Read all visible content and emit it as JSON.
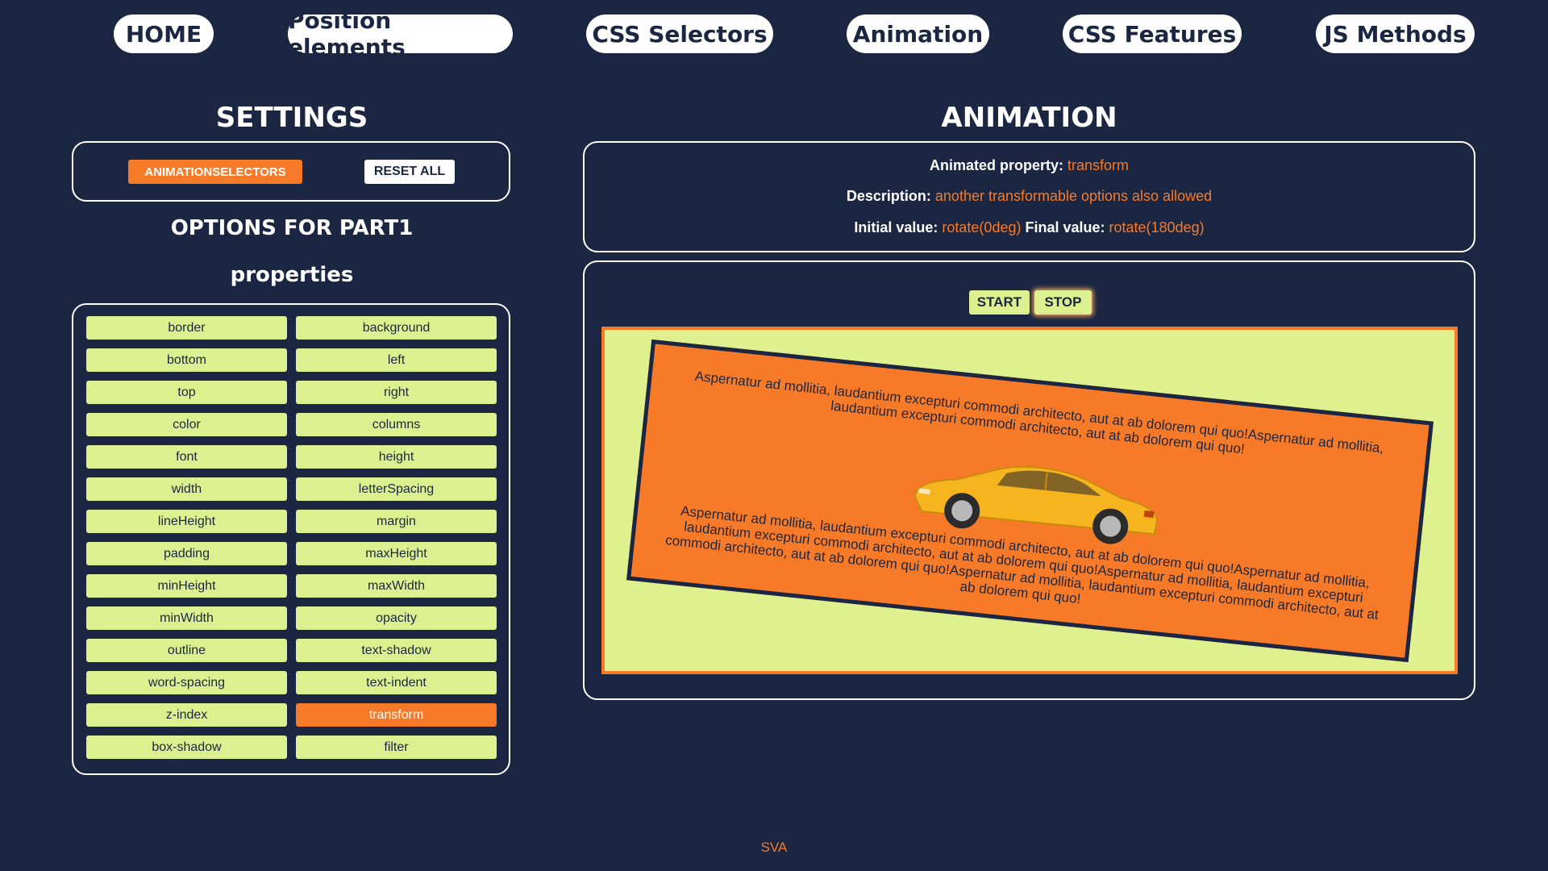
{
  "nav": {
    "home": "HOME",
    "position": "Position elements",
    "selectors": "CSS Selectors",
    "animation": "Animation",
    "features": "CSS Features",
    "js": "JS Methods"
  },
  "settings": {
    "title": "SETTINGS",
    "animation_selectors": "ANIMATIONSELECTORS",
    "reset_all": "RESET ALL",
    "options_title": "OPTIONS FOR PART1",
    "properties_title": "properties",
    "properties": [
      "border",
      "background",
      "bottom",
      "left",
      "top",
      "right",
      "color",
      "columns",
      "font",
      "height",
      "width",
      "letterSpacing",
      "lineHeight",
      "margin",
      "padding",
      "maxHeight",
      "minHeight",
      "maxWidth",
      "minWidth",
      "opacity",
      "outline",
      "text-shadow",
      "word-spacing",
      "text-indent",
      "z-index",
      "transform",
      "box-shadow",
      "filter"
    ],
    "active_property": "transform"
  },
  "animation": {
    "title": "ANIMATION",
    "animated_property_label": "Animated property:",
    "animated_property_value": "transform",
    "description_label": "Description:",
    "description_value": "another transformable options also allowed",
    "initial_label": "Initial value:",
    "initial_value": "rotate(0deg)",
    "final_label": "Final value:",
    "final_value": "rotate(180deg)",
    "start": "START",
    "stop": "STOP",
    "text1": "Aspernatur ad mollitia, laudantium excepturi commodi architecto, aut at ab dolorem qui quo!Aspernatur ad mollitia, laudantium excepturi commodi architecto, aut at ab dolorem qui quo!",
    "text2": "Aspernatur ad mollitia, laudantium excepturi commodi architecto, aut at ab dolorem qui quo!Aspernatur ad mollitia, laudantium excepturi commodi architecto, aut at ab dolorem qui quo!Aspernatur ad mollitia, laudantium excepturi commodi architecto, aut at ab dolorem qui quo!Aspernatur ad mollitia, laudantium excepturi commodi architecto, aut at ab dolorem qui quo!",
    "image_icon": "car-icon"
  },
  "footer": "SVA",
  "colors": {
    "background": "#1b2742",
    "accent": "#f77a28",
    "button_light": "#ddf08f",
    "stage": "#dff18f"
  }
}
